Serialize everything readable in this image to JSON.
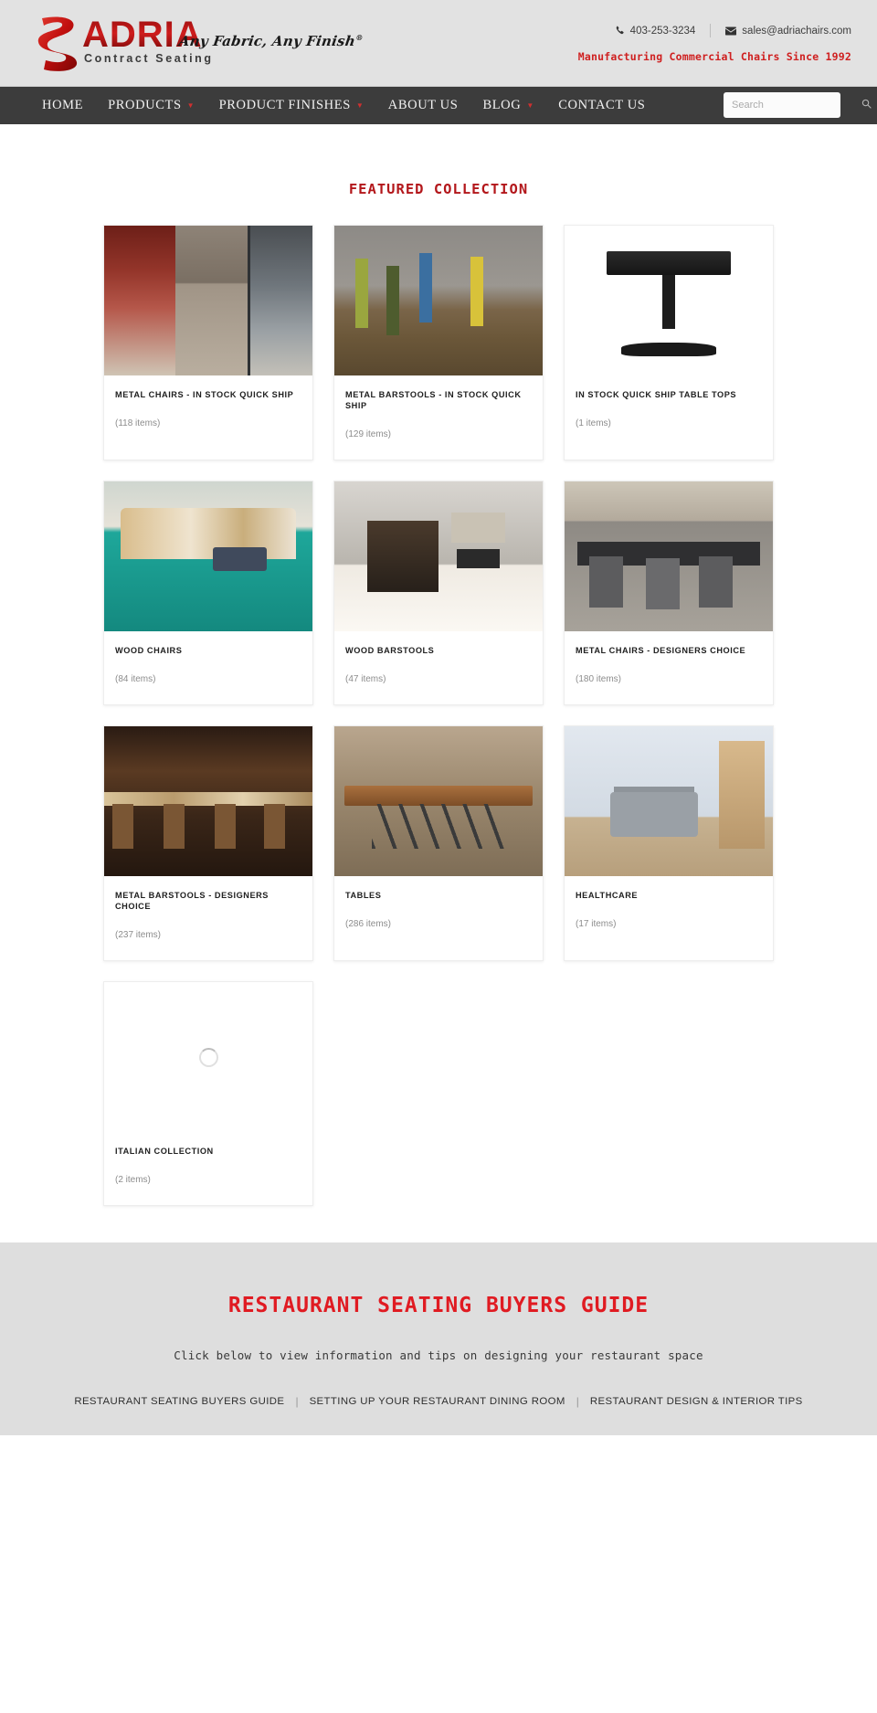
{
  "header": {
    "logo": {
      "brand": "ADRIA",
      "sub": "Contract Seating",
      "tagline": "Any Fabric, Any Finish",
      "tagline_mark": "®"
    },
    "contact": {
      "phone": "403-253-3234",
      "email": "sales@adriachairs.com",
      "phone_icon": "phone-icon",
      "email_icon": "envelope-icon"
    },
    "since_line": "Manufacturing Commercial Chairs Since 1992",
    "since_color": "#cf2020"
  },
  "nav": {
    "items": [
      {
        "label": "HOME",
        "has_dropdown": false
      },
      {
        "label": "PRODUCTS",
        "has_dropdown": true
      },
      {
        "label": "PRODUCT FINISHES",
        "has_dropdown": true
      },
      {
        "label": "ABOUT US",
        "has_dropdown": false
      },
      {
        "label": "BLOG",
        "has_dropdown": true
      },
      {
        "label": "CONTACT US",
        "has_dropdown": false
      }
    ],
    "search": {
      "placeholder": "Search",
      "value": "",
      "icon": "search-icon"
    },
    "bg_color": "#3c3c3c",
    "caret_color": "#d03030"
  },
  "main": {
    "section_title": "FEATURED COLLECTION",
    "section_title_color": "#b3171b",
    "cards": [
      {
        "title": "METAL CHAIRS - IN STOCK QUICK SHIP",
        "count": "(118 items)",
        "art": "i1",
        "loading": false
      },
      {
        "title": "METAL BARSTOOLS - IN STOCK QUICK SHIP",
        "count": "(129 items)",
        "art": "i2",
        "loading": false
      },
      {
        "title": "IN STOCK QUICK SHIP TABLE TOPS",
        "count": "(1 items)",
        "art": "i3",
        "loading": false
      },
      {
        "title": "WOOD CHAIRS",
        "count": "(84 items)",
        "art": "i4",
        "loading": false
      },
      {
        "title": "WOOD BARSTOOLS",
        "count": "(47 items)",
        "art": "i5",
        "loading": false
      },
      {
        "title": "METAL CHAIRS - DESIGNERS CHOICE",
        "count": "(180 items)",
        "art": "i6",
        "loading": false
      },
      {
        "title": "METAL BARSTOOLS - DESIGNERS CHOICE",
        "count": "(237 items)",
        "art": "i7",
        "loading": false
      },
      {
        "title": "TABLES",
        "count": "(286 items)",
        "art": "i8x",
        "loading": false
      },
      {
        "title": "HEALTHCARE",
        "count": "(17 items)",
        "art": "i9x",
        "loading": false
      },
      {
        "title": "ITALIAN COLLECTION",
        "count": "(2 items)",
        "art": "blank",
        "loading": true
      }
    ]
  },
  "guide": {
    "title": "RESTAURANT SEATING BUYERS GUIDE",
    "title_color": "#e01b22",
    "subtitle": "Click below to view information and tips on designing your restaurant space",
    "links": [
      "RESTAURANT SEATING BUYERS GUIDE",
      "SETTING UP YOUR RESTAURANT DINING ROOM",
      "RESTAURANT DESIGN & INTERIOR TIPS"
    ],
    "divider": "|",
    "bg_color": "#dedede"
  }
}
